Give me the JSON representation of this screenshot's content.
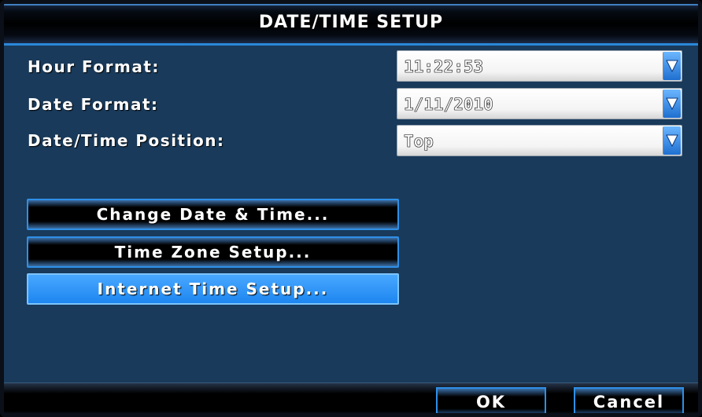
{
  "title": "DATE/TIME SETUP",
  "fields": [
    {
      "label": "Hour Format:",
      "value": "11:22:53"
    },
    {
      "label": "Date Format:",
      "value": "1/11/2010"
    },
    {
      "label": "Date/Time Position:",
      "value": "Top"
    }
  ],
  "buttons": {
    "change_date_time": "Change Date & Time...",
    "time_zone_setup": "Time Zone Setup...",
    "internet_time_setup": "Internet Time Setup..."
  },
  "footer": {
    "ok": "OK",
    "cancel": "Cancel"
  },
  "selected_button": "internet_time_setup",
  "colors": {
    "panel": "#193a5a",
    "accent": "#2f8fe6",
    "selected": "#1d86f0"
  }
}
